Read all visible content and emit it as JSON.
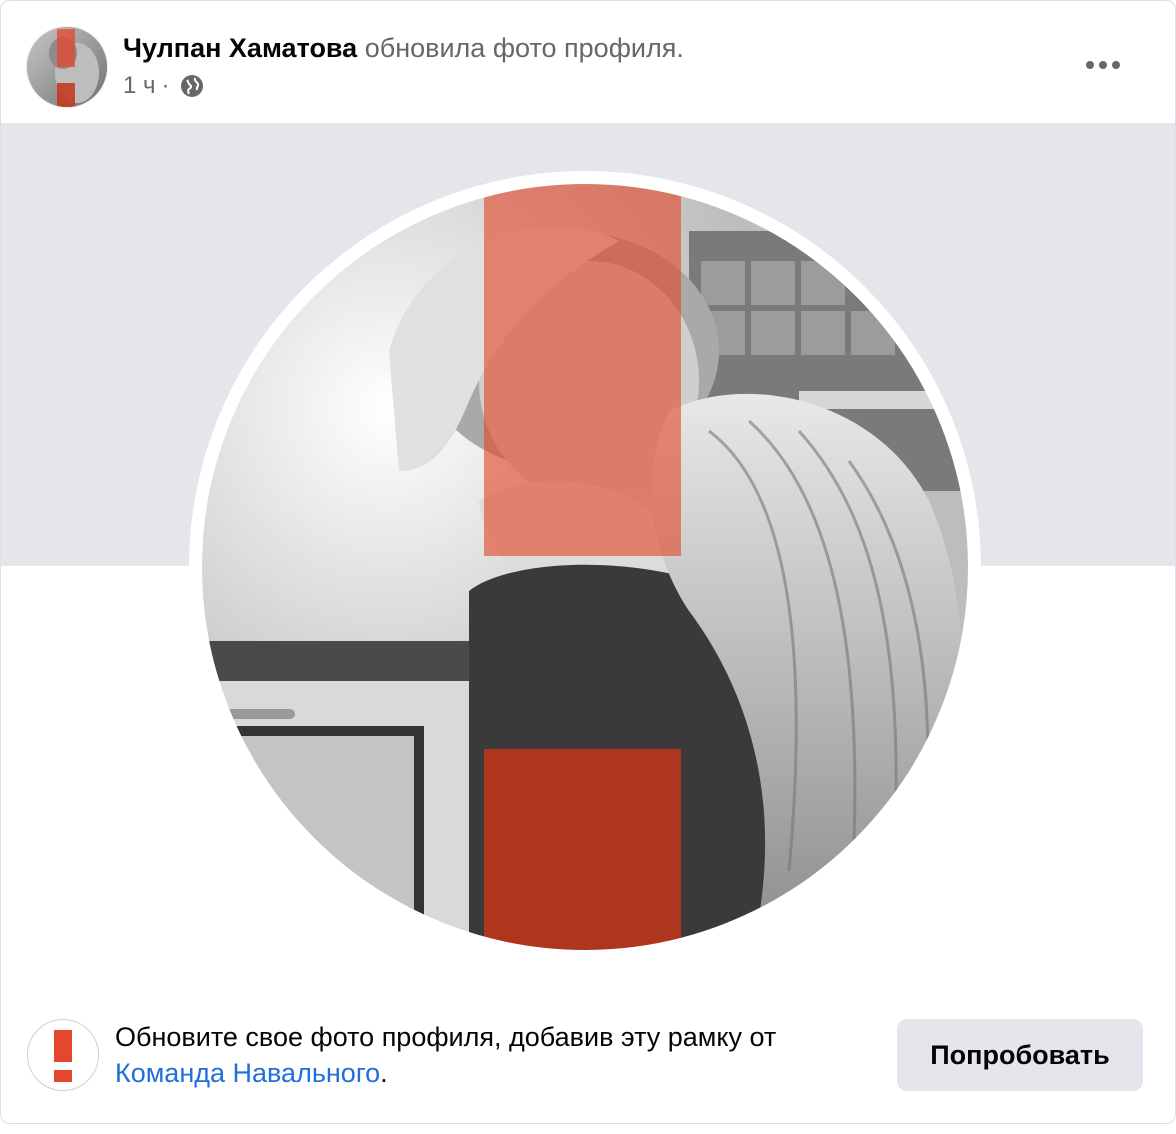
{
  "post": {
    "author_name": "Чулпан Хаматова",
    "action_text": "обновила фото профиля.",
    "time": "1 ч",
    "separator": "·",
    "privacy_icon": "globe-icon",
    "more_icon": "more-options-icon"
  },
  "profile_photo": {
    "frame_color": "#e4472b",
    "description_icon": "profile-photo-with-frame"
  },
  "footer": {
    "prompt_text": "Обновите свое фото профиля, добавив эту рамку от ",
    "frame_author": "Команда Навального",
    "prompt_end": ".",
    "button_label": "Попробовать",
    "frame_icon": "exclamation-frame-icon"
  },
  "colors": {
    "link": "#216fdb",
    "secondary_text": "#65676b",
    "cover_band": "#e4e6eb",
    "frame_red": "#e4472b"
  }
}
